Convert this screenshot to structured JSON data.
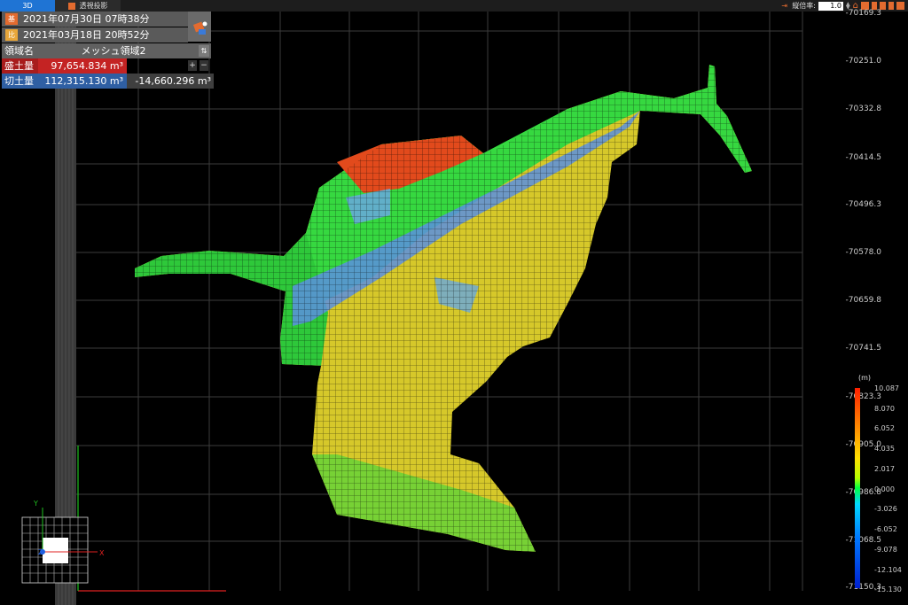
{
  "toolbar": {
    "tab_3d": "3D",
    "tab_perspective": "透視投影",
    "vertical_scale_label": "縦倍率:",
    "vertical_scale_value": "1.0"
  },
  "panel": {
    "base_tag": "基",
    "base_date": "2021年07月30日 07時38分",
    "compare_tag": "比",
    "compare_date": "2021年03月18日 20時52分",
    "region_label": "領域名",
    "region_name": "メッシュ領域2",
    "fill_label": "盛土量",
    "fill_value": "97,654.834 m³",
    "cut_label": "切土量",
    "cut_value": "112,315.130 m³",
    "difference_value": "-14,660.296 m³",
    "plus": "+",
    "minus": "−"
  },
  "y_axis_labels": [
    "-70169.3",
    "-70251.0",
    "-70332.8",
    "-70414.5",
    "-70496.3",
    "-70578.0",
    "-70659.8",
    "-70741.5",
    "-70823.3",
    "-70905.0",
    "-70986.8",
    "-71068.5",
    "-71150.3"
  ],
  "legend": {
    "unit": "(m)",
    "labels": [
      "10.087",
      "8.070",
      "6.052",
      "4.035",
      "2.017",
      "0.000",
      "-3.026",
      "-6.052",
      "-9.078",
      "-12.104",
      "-15.130"
    ],
    "top_color": "#ff2000",
    "bottom_color": "#0020d0"
  },
  "axes": {
    "x": "X",
    "y": "Y",
    "z": "Z"
  },
  "colors": {
    "fill": "#c42323",
    "cut": "#2f5fa3",
    "accent": "#1f74d4"
  }
}
